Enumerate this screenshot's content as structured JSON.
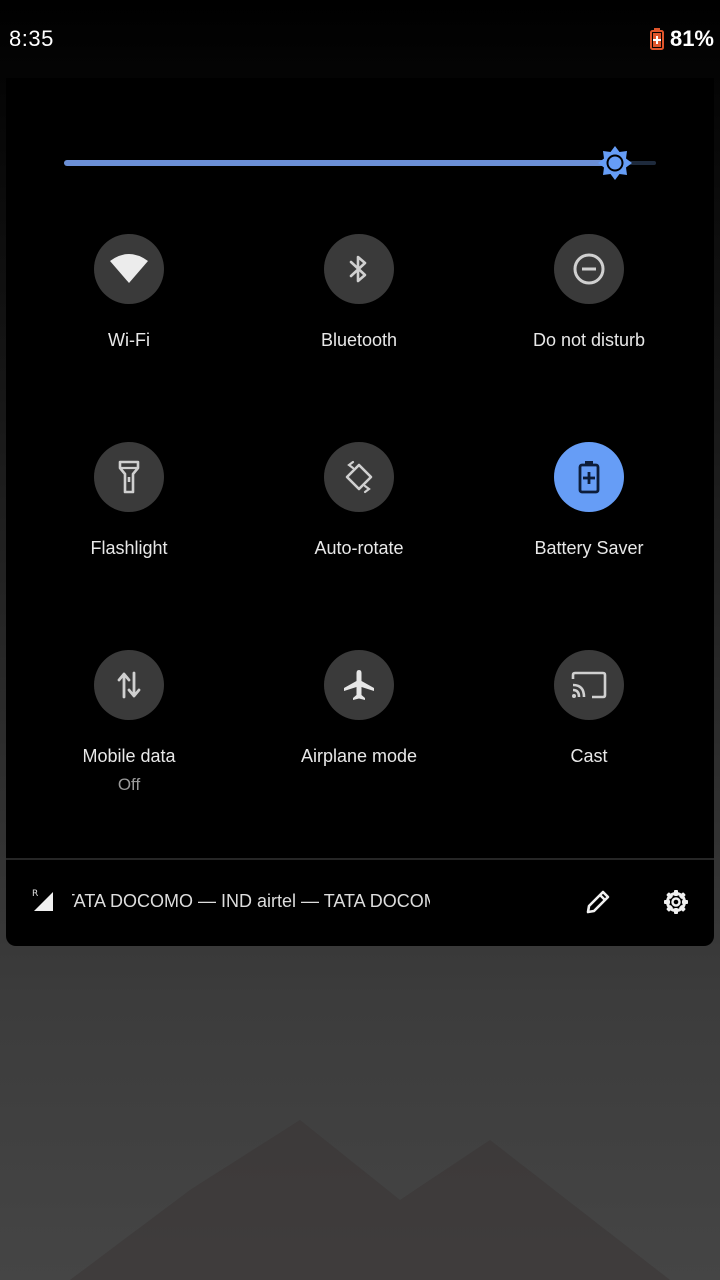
{
  "status": {
    "time": "8:35",
    "battery_percent": "81%"
  },
  "brightness": {
    "level": 0.93,
    "accent": "#669df6"
  },
  "tiles": [
    {
      "label": "Wi-Fi",
      "icon": "wifi-icon",
      "active": false
    },
    {
      "label": "Bluetooth",
      "icon": "bluetooth-icon",
      "active": false
    },
    {
      "label": "Do not disturb",
      "icon": "do-not-disturb-icon",
      "active": false
    },
    {
      "label": "Flashlight",
      "icon": "flashlight-icon",
      "active": false
    },
    {
      "label": "Auto-rotate",
      "icon": "auto-rotate-icon",
      "active": false
    },
    {
      "label": "Battery Saver",
      "icon": "battery-saver-icon",
      "active": true
    },
    {
      "label": "Mobile data",
      "sublabel": "Off",
      "icon": "mobile-data-icon",
      "active": false
    },
    {
      "label": "Airplane mode",
      "icon": "airplane-icon",
      "active": false
    },
    {
      "label": "Cast",
      "icon": "cast-icon",
      "active": false
    }
  ],
  "footer": {
    "roaming_indicator": "R",
    "carrier_text": "TATA DOCOMO — IND airtel — TATA DOCOMO",
    "edit_icon": "pencil-icon",
    "settings_icon": "gear-icon"
  }
}
